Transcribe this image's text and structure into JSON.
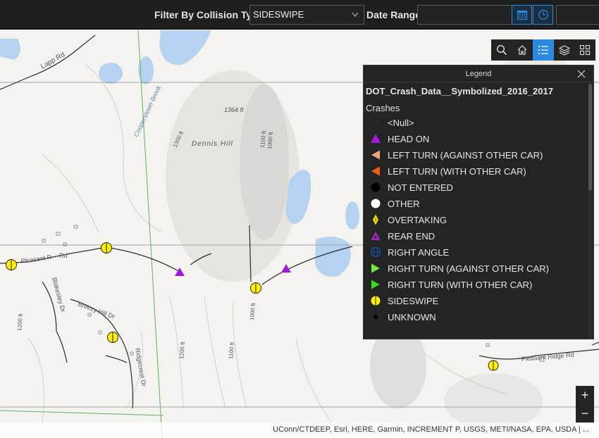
{
  "topbar": {
    "filter_label": "Filter By Collision Type",
    "filter_value": "SIDESWIPE",
    "date_label": "Date Range"
  },
  "map": {
    "labels": {
      "road_lapp": "Lapp Rd",
      "brook": "Cooperstown Brook",
      "peak": "1364 ft",
      "hill": "Dennis Hill",
      "elev_1300": "1300 ft",
      "elev_1100a": "1100 ft",
      "elev_1000a": "1000 ft",
      "pleasant_r": "Pleasant R",
      "rd_abbrev": "Rd",
      "blakesley": "Blakesley Dr",
      "breezy": "Breezy Hill Dr",
      "elev_1200a": "1200 ft",
      "elev_1200b": "1200 ft",
      "ridgecrest": "Ridgecrest Dr",
      "elev_1100b": "1100 ft",
      "elev_1000b": "1000 ft",
      "pleasant_ridge": "Pleasant Ridge Rd"
    }
  },
  "toolbar": {
    "icons": [
      "search-icon",
      "home-icon",
      "legend-icon",
      "layers-icon",
      "basemap-gallery-icon"
    ],
    "active": "legend-icon"
  },
  "legend": {
    "title": "Legend",
    "layer": "DOT_Crash_Data__Symbolized_2016_2017",
    "group": "Crashes",
    "items": [
      {
        "label": "<Null>",
        "symbol": "dot",
        "color": "#000000"
      },
      {
        "label": "HEAD ON",
        "symbol": "triangle",
        "color": "#a21cdb"
      },
      {
        "label": "LEFT TURN (AGAINST OTHER CAR)",
        "symbol": "left-triangle",
        "color": "#f5a57c"
      },
      {
        "label": "LEFT TURN (WITH OTHER CAR)",
        "symbol": "left-triangle",
        "color": "#f25c13"
      },
      {
        "label": "NOT ENTERED",
        "symbol": "circle",
        "color": "#000000"
      },
      {
        "label": "OTHER",
        "symbol": "circle",
        "color": "#ffffff"
      },
      {
        "label": "OVERTAKING",
        "symbol": "diamond",
        "color": "#f7e400"
      },
      {
        "label": "REAR END",
        "symbol": "triangle-hollow",
        "color": "#b01ed0"
      },
      {
        "label": "RIGHT ANGLE",
        "symbol": "globe",
        "color": "#1a4fa3"
      },
      {
        "label": "RIGHT TURN (AGAINST OTHER CAR)",
        "symbol": "right-triangle",
        "color": "#78e63c"
      },
      {
        "label": "RIGHT TURN (WITH OTHER CAR)",
        "symbol": "right-triangle",
        "color": "#3ad61e"
      },
      {
        "label": "SIDESWIPE",
        "symbol": "circle-split",
        "color": "#ffef00"
      },
      {
        "label": "UNKNOWN",
        "symbol": "square",
        "color": "#000000"
      }
    ]
  },
  "zoom": {
    "in": "+",
    "out": "−"
  },
  "attribution": "UConn/CTDEEP, Esri, HERE, Garmin, INCREMENT P, USGS, METI/NASA, EPA, USDA | ...",
  "colors": {
    "accent": "#2a8ae0",
    "panel": "#242424",
    "water": "#b5d3f0",
    "sideswipe": "#ffef00"
  }
}
